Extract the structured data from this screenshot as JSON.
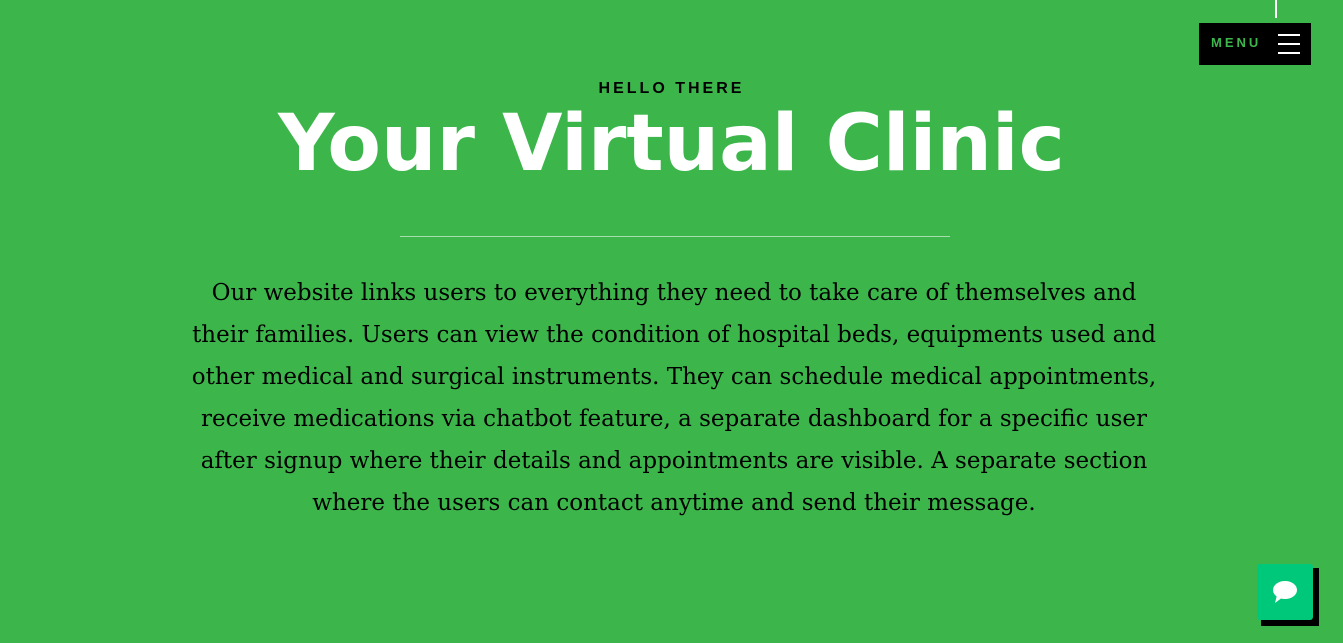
{
  "header": {
    "menu_label": "MENU",
    "menu_icon": "hamburger-icon"
  },
  "hero": {
    "eyebrow": "HELLO THERE",
    "title": "Your Virtual Clinic",
    "description": "Our website links users to everything they need to take care of themselves and their families. Users can view the condition of hospital beds, equipments used and other medical and surgical instruments. They can schedule medical appointments, receive medications via chatbot feature, a separate dashboard for a specific user after signup where their details and appointments are visible. A separate section where the users can contact anytime and send their message."
  },
  "chat_widget": {
    "icon": "chat-bubble-icon"
  },
  "colors": {
    "background": "#3cb64b",
    "title": "#ffffff",
    "text": "#000000",
    "menu_background": "#000000",
    "menu_label": "#3cb64b",
    "chat_button": "#00c87a"
  }
}
